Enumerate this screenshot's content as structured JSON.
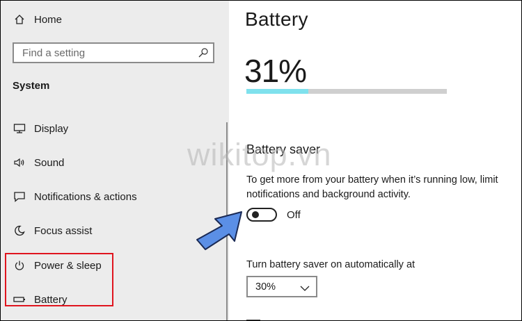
{
  "sidebar": {
    "home_label": "Home",
    "search_placeholder": "Find a setting",
    "section_title": "System",
    "items": [
      {
        "label": "Display",
        "icon": "monitor-icon"
      },
      {
        "label": "Sound",
        "icon": "speaker-icon"
      },
      {
        "label": "Notifications & actions",
        "icon": "notification-icon"
      },
      {
        "label": "Focus assist",
        "icon": "moon-icon"
      },
      {
        "label": "Power & sleep",
        "icon": "power-icon"
      },
      {
        "label": "Battery",
        "icon": "battery-icon"
      }
    ]
  },
  "main": {
    "title": "Battery",
    "battery_percent_text": "31%",
    "battery_level": 0.31,
    "battery_saver": {
      "title": "Battery saver",
      "description_line1": "To get more from your battery when it’s running low, limit",
      "description_line2": "notifications and background activity.",
      "toggle_state": "Off",
      "auto_label": "Turn battery saver on automatically at",
      "auto_value": "30%"
    }
  },
  "overlay": {
    "watermark": "wikitop.vn",
    "highlight_color": "#e0141e",
    "arrow_color": "#5b8fe6"
  },
  "colors": {
    "sidebar_bg": "#ececec",
    "progress_fill": "#7fe1ed",
    "progress_track": "#cfcfcf"
  }
}
